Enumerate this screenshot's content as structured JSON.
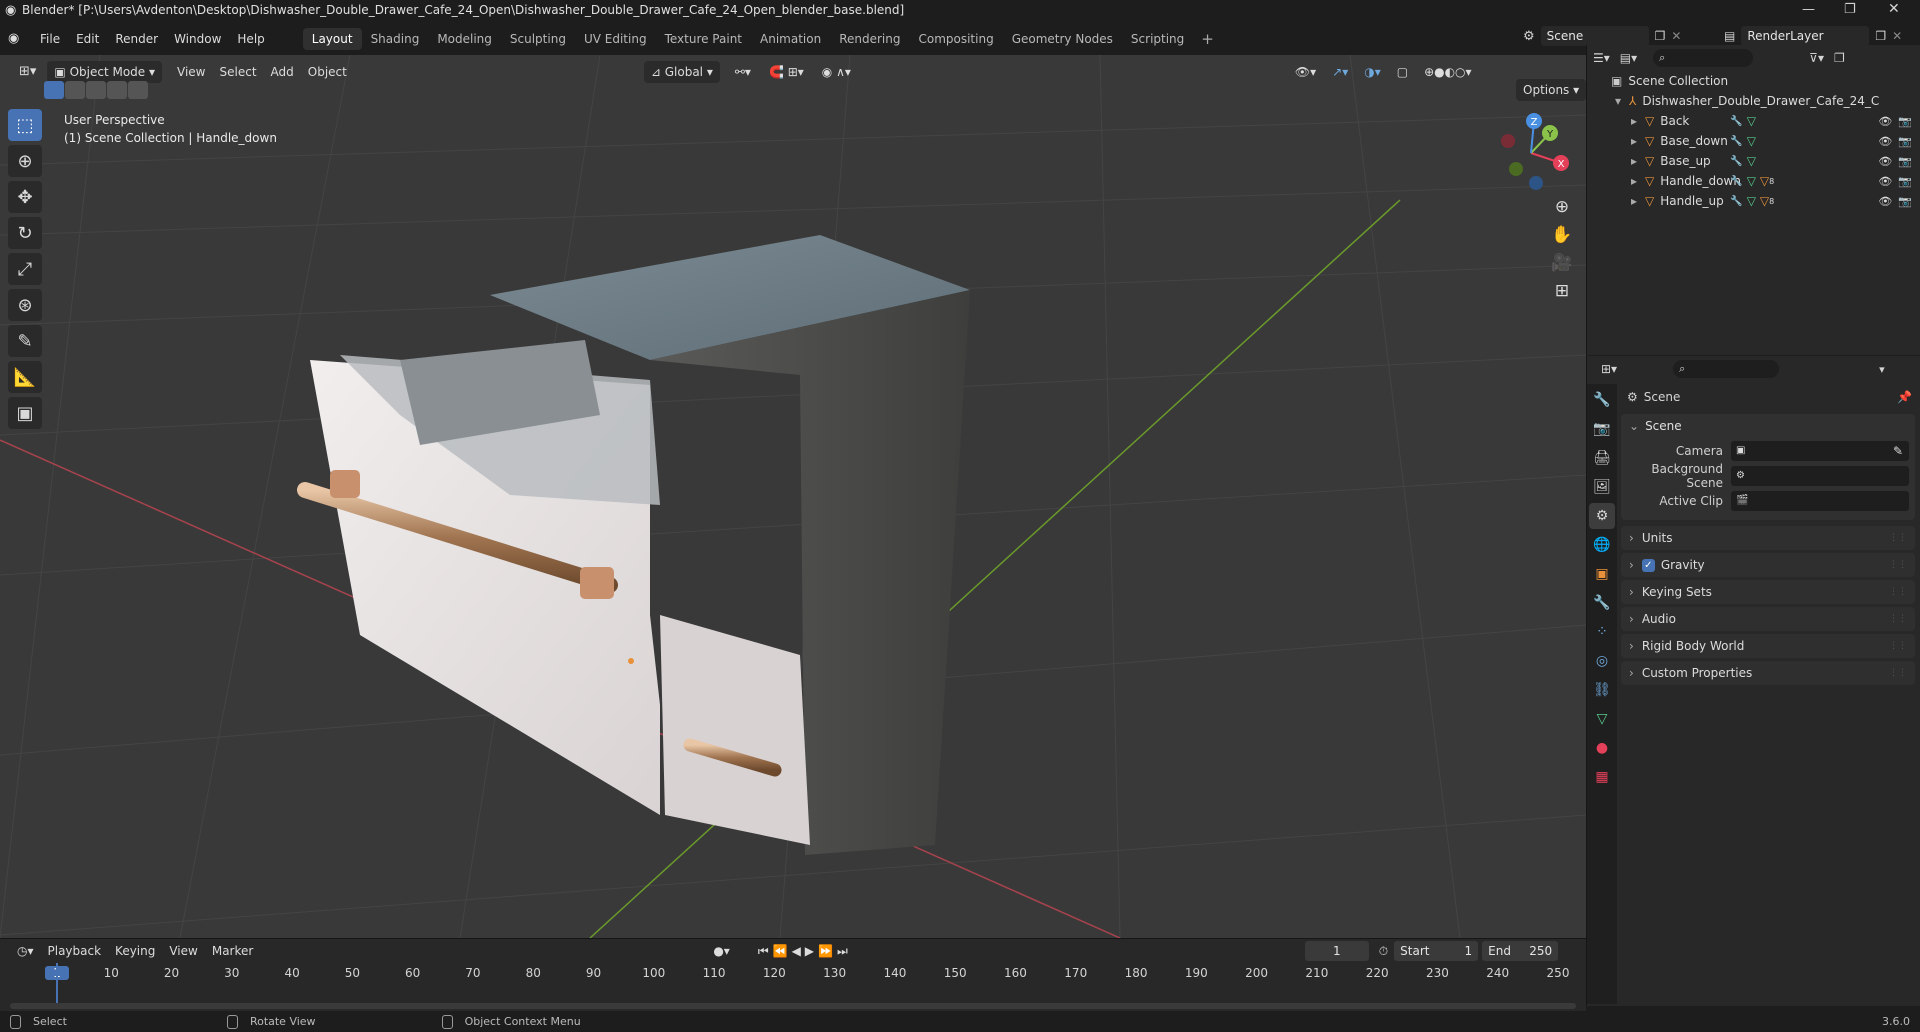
{
  "window": {
    "title": "Blender* [P:\\Users\\Avdenton\\Desktop\\Dishwasher_Double_Drawer_Cafe_24_Open\\Dishwasher_Double_Drawer_Cafe_24_Open_blender_base.blend]"
  },
  "menus": [
    "File",
    "Edit",
    "Render",
    "Window",
    "Help"
  ],
  "workspaces": [
    "Layout",
    "Shading",
    "Modeling",
    "Sculpting",
    "UV Editing",
    "Texture Paint",
    "Animation",
    "Rendering",
    "Compositing",
    "Geometry Nodes",
    "Scripting"
  ],
  "active_workspace": "Layout",
  "scene_selector": {
    "value": "Scene"
  },
  "renderlayer_selector": {
    "value": "RenderLayer"
  },
  "viewport": {
    "mode": "Object Mode",
    "menus": [
      "View",
      "Select",
      "Add",
      "Object"
    ],
    "transform_orientation": "Global",
    "options_label": "Options",
    "overlay_title": "User Perspective",
    "overlay_subtitle": "(1) Scene Collection | Handle_down",
    "gizmo": {
      "x": "X",
      "y": "Y",
      "z": "Z"
    }
  },
  "outliner": {
    "root": "Scene Collection",
    "collection": "Dishwasher_Double_Drawer_Cafe_24_C",
    "objects": [
      {
        "name": "Back",
        "badge": ""
      },
      {
        "name": "Base_down",
        "badge": ""
      },
      {
        "name": "Base_up",
        "badge": ""
      },
      {
        "name": "Handle_down",
        "badge": "8"
      },
      {
        "name": "Handle_up",
        "badge": "8"
      }
    ]
  },
  "properties": {
    "context": "Scene",
    "panel_title": "Scene",
    "fields": [
      {
        "label": "Camera",
        "value": ""
      },
      {
        "label": "Background Scene",
        "value": ""
      },
      {
        "label": "Active Clip",
        "value": ""
      }
    ],
    "collapsed_panels": [
      "Units",
      "Gravity",
      "Keying Sets",
      "Audio",
      "Rigid Body World",
      "Custom Properties"
    ],
    "gravity_checked": true
  },
  "timeline": {
    "menus": [
      "Playback",
      "Keying",
      "View",
      "Marker"
    ],
    "current_frame": "1",
    "start_label": "Start",
    "start_value": "1",
    "end_label": "End",
    "end_value": "250",
    "ruler": [
      "1",
      "10",
      "20",
      "30",
      "40",
      "50",
      "60",
      "70",
      "80",
      "90",
      "100",
      "110",
      "120",
      "130",
      "140",
      "150",
      "160",
      "170",
      "180",
      "190",
      "200",
      "210",
      "220",
      "230",
      "240",
      "250"
    ]
  },
  "statusbar": {
    "select": "Select",
    "rotate": "Rotate View",
    "context_menu": "Object Context Menu",
    "version": "3.6.0"
  },
  "colors": {
    "accent": "#4772b3",
    "object_orange": "#e8913a",
    "modifier_blue": "#6fa8dc",
    "mesh_green": "#57c98b",
    "x_axis": "#e5405a",
    "y_axis": "#8bc34a",
    "z_axis": "#4a90e2"
  }
}
